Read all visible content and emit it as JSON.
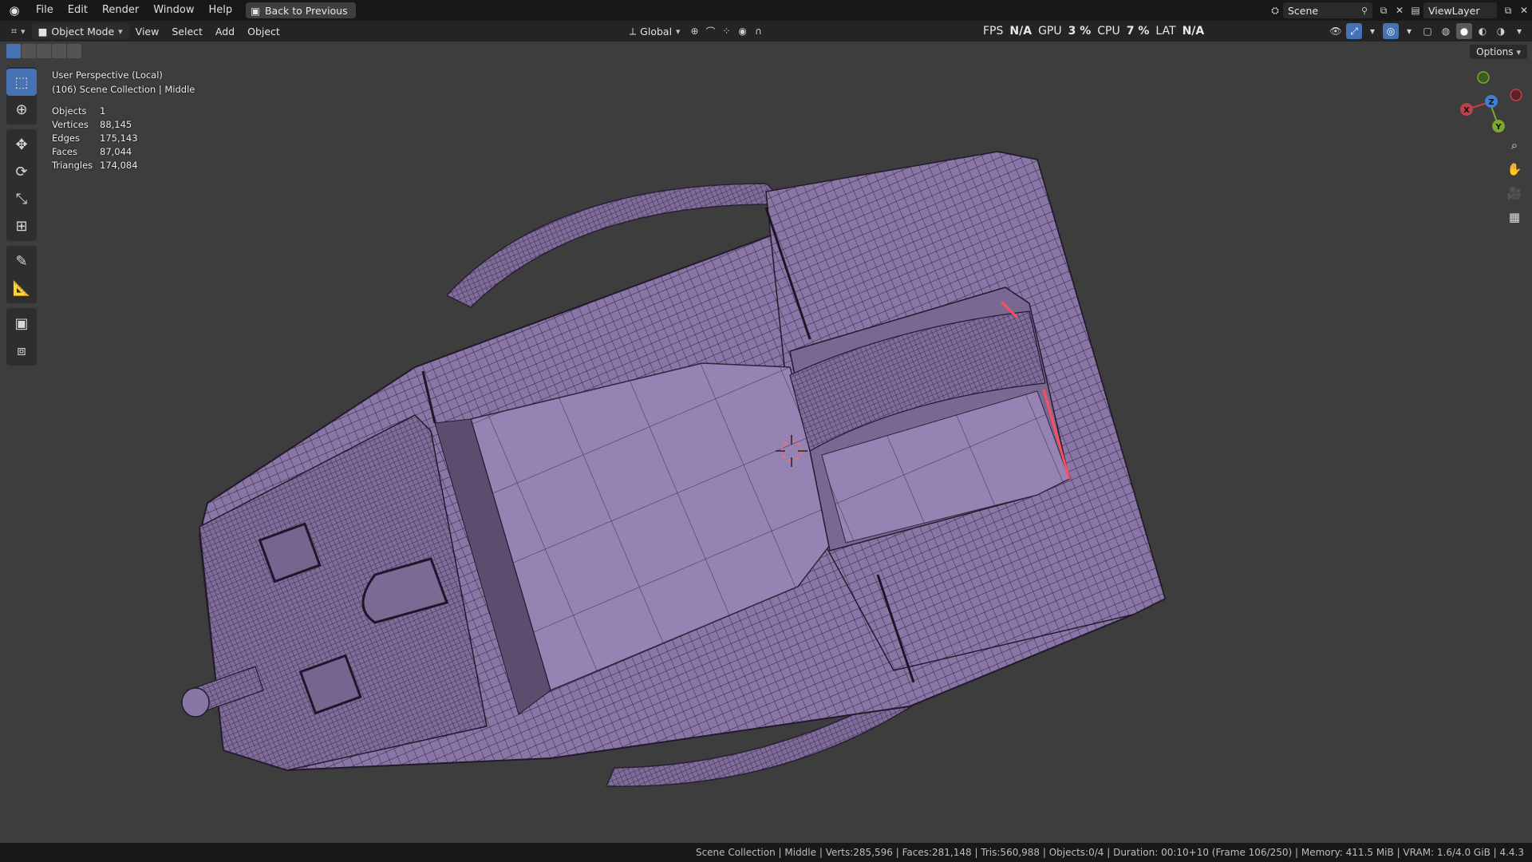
{
  "menubar": {
    "items": [
      "File",
      "Edit",
      "Render",
      "Window",
      "Help"
    ],
    "back_label": "Back to Previous",
    "scene_label": "Scene",
    "viewlayer_label": "ViewLayer"
  },
  "header": {
    "mode_label": "Object Mode",
    "menus": [
      "View",
      "Select",
      "Add",
      "Object"
    ],
    "transform_orientation": "Global",
    "options_label": "Options"
  },
  "performance": {
    "fps_label": "FPS",
    "fps_value": "N/A",
    "gpu_label": "GPU",
    "gpu_value": "3 %",
    "cpu_label": "CPU",
    "cpu_value": "7 %",
    "lat_label": "LAT",
    "lat_value": "N/A"
  },
  "viewport": {
    "view_name": "User Perspective (Local)",
    "collection_line": "(106) Scene Collection | Middle",
    "stats": [
      {
        "label": "Objects",
        "value": "1"
      },
      {
        "label": "Vertices",
        "value": "88,145"
      },
      {
        "label": "Edges",
        "value": "175,143"
      },
      {
        "label": "Faces",
        "value": "87,044"
      },
      {
        "label": "Triangles",
        "value": "174,084"
      }
    ]
  },
  "gizmo": {
    "x_label": "X",
    "y_label": "Y",
    "z_label": "Z"
  },
  "colors": {
    "accent": "#4772b3",
    "mesh_fill": "#8a76a6",
    "mesh_wire": "#2a1f35",
    "viewport_bg": "#3d3d3d"
  },
  "statusbar": {
    "text": "Scene Collection | Middle | Verts:285,596 | Faces:281,148 | Tris:560,988 | Objects:0/4 | Duration: 00:10+10 (Frame 106/250) | Memory: 411.5 MiB | VRAM: 1.6/4.0 GiB | 4.4.3"
  }
}
